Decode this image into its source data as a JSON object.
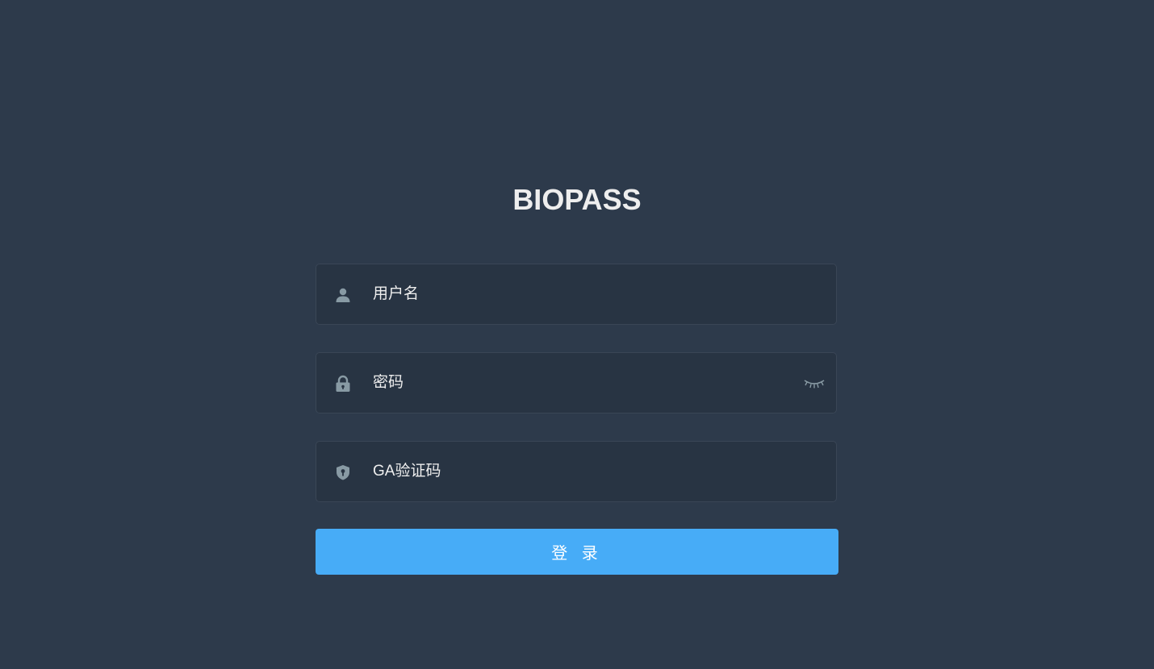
{
  "title": "BIOPASS",
  "form": {
    "username": {
      "placeholder": "用户名",
      "value": "",
      "icon": "user-icon"
    },
    "password": {
      "placeholder": "密码",
      "value": "",
      "icon": "lock-icon",
      "toggle_icon": "eye-closed-icon"
    },
    "ga_code": {
      "placeholder": "GA验证码",
      "value": "",
      "icon": "shield-icon"
    },
    "submit_label": "登 录"
  },
  "colors": {
    "background": "#2d3a4b",
    "input_background": "#283443",
    "input_border": "#3a4656",
    "button": "#47acf7",
    "text": "#eeeeee",
    "icon": "#889aa4"
  }
}
